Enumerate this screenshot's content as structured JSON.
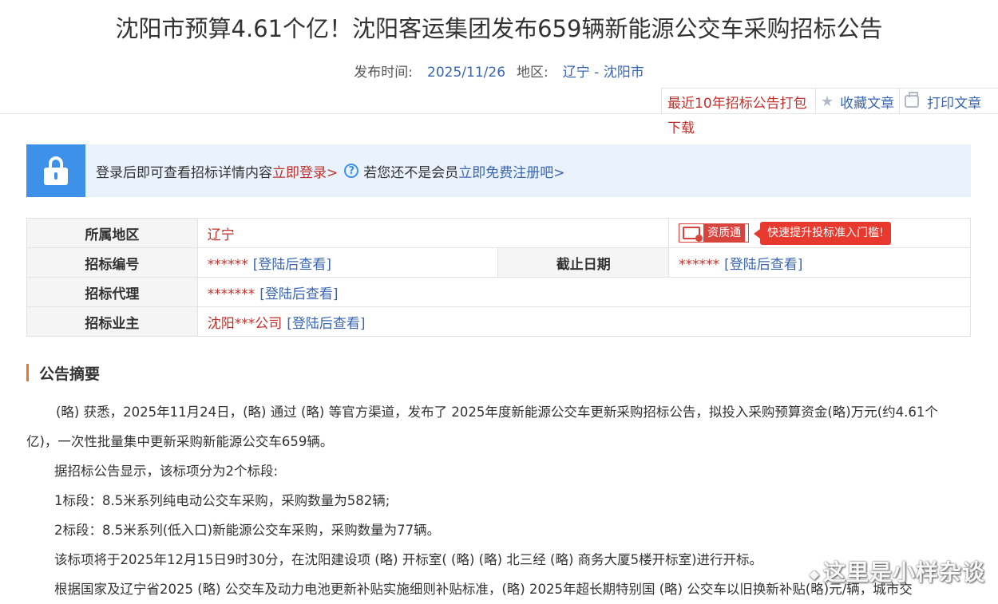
{
  "title": "沈阳市预算4.61个亿！沈阳客运集团发布659辆新能源公交车采购招标公告",
  "meta": {
    "publish_label": "发布时间:",
    "publish_date": "2025/11/26",
    "region_label": "地区:",
    "region_value": "辽宁 - 沈阳市"
  },
  "actions": {
    "download_label": "最近10年招标公告打包下载",
    "favorite_label": "收藏文章",
    "print_label": "打印文章"
  },
  "login_banner": {
    "prompt": "登录后即可查看招标详情内容",
    "login_link": "立即登录>",
    "member_prompt": "若您还不是会员",
    "register_link": "立即免费注册吧>"
  },
  "info_table": {
    "region_label": "所属地区",
    "region_value": "辽宁",
    "qualification_badge": "资质通",
    "qualification_tip": "快速提升投标准入门槛!",
    "bid_no_label": "招标编号",
    "bid_no_mask": "******",
    "deadline_label": "截止日期",
    "deadline_mask": "******",
    "agent_label": "招标代理",
    "agent_mask": "*******",
    "owner_label": "招标业主",
    "owner_value": "沈阳***公司",
    "view_after_login": "[登陆后查看]"
  },
  "summary": {
    "heading": "公告摘要",
    "paragraphs": [
      "(略) 获悉，2025年11月24日，(略) 通过 (略) 等官方渠道，发布了 2025年度新能源公交车更新采购招标公告，拟投入采购预算资金(略)万元(约4.61个亿)，一次性批量集中更新采购新能源公交车659辆。",
      "据招标公告显示，该标项分为2个标段:",
      "1标段：8.5米系列纯电动公交车采购，采购数量为582辆;",
      "2标段：8.5米系列(低入口)新能源公交车采购，采购数量为77辆。",
      "该标项将于2025年12月15日9时30分，在沈阳建设项 (略) 开标室( (略) (略) 北三经 (略) 商务大厦5楼开标室)进行开标。",
      "根据国家及辽宁省2025 (略) 公交车及动力电池更新补贴实施细则补贴标准，(略) 2025年超长期特别国 (略) 公交车以旧换新补贴(略)元/辆，城市交"
    ]
  },
  "watermark": "这里是小样杂谈"
}
